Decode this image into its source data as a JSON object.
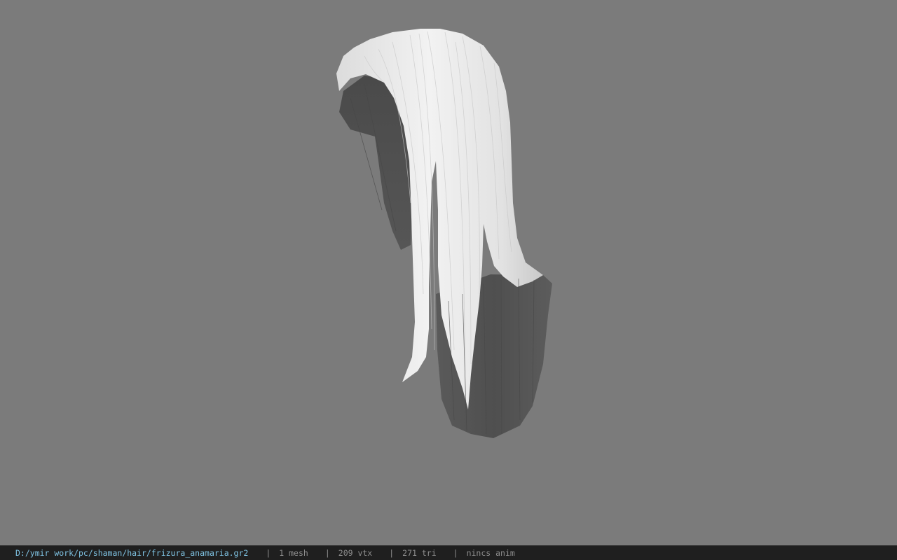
{
  "viewer": {
    "background_color": "#7b7b7b",
    "model": "hair-mesh"
  },
  "statusbar": {
    "file_path": "D:/ymir work/pc/shaman/hair/frizura_anamaria.gr2",
    "separator": "|",
    "mesh_count": "1 mesh",
    "vertex_count": "209 vtx",
    "triangle_count": "271 tri",
    "anim_status": "nincs anim",
    "path_color": "#7fc3e3",
    "text_color": "#8e8e8e"
  }
}
